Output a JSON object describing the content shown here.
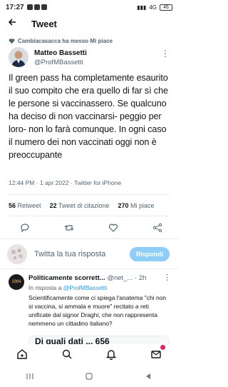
{
  "status_bar": {
    "time": "17:27",
    "signal": "4G",
    "battery": "46"
  },
  "header": {
    "title": "Tweet"
  },
  "context": {
    "label": "Cambiacasacca ha messo Mi piace"
  },
  "author": {
    "name": "Matteo Bassetti",
    "handle": "@ProfMBassetti"
  },
  "tweet": {
    "text": "Il green pass ha completamente esaurito il suo compito che era quello di far sì che le persone si vaccinassero. Se qualcuno ha deciso di non vaccinarsi- peggio per loro- non lo farà comunque. In ogni caso il numero dei non vaccinati oggi non è preoccupante",
    "meta": "12:44 PM · 1 apr 2022 · Twitter for iPhone"
  },
  "stats": {
    "retweets_count": "56",
    "retweets_label": "Retweet",
    "quotes_count": "22",
    "quotes_label": "Tweet di citazione",
    "likes_count": "270",
    "likes_label": "Mi piace"
  },
  "reply_box": {
    "placeholder": "Twitta la tua risposta",
    "button_label": "Rispondi"
  },
  "reply": {
    "name": "Politicamente scorrett...",
    "handle": "@net_...",
    "time": "· 2h",
    "replying_prefix": "In risposta a",
    "replying_to": "@ProfMBassetti",
    "text": "Scientificamente come ci spiega l'anatema \"chi non si vaccina, si ammala e muore\" recitato a reti unificate dal signor Draghi, che non rappresenta nemmeno un cittadino italiano?",
    "avatar_text": "1984",
    "card_preview": "Di quali dati ... 656"
  },
  "icons": {
    "back": "arrow-left-icon",
    "heart": "heart-icon",
    "verified": "none",
    "home": "home-icon",
    "search": "search-icon",
    "bell": "bell-icon",
    "mail": "mail-icon"
  },
  "colors": {
    "accent": "#1d9bf0",
    "reply_button": "#8ecdf8",
    "text": "#0f1419",
    "muted": "#536471"
  }
}
